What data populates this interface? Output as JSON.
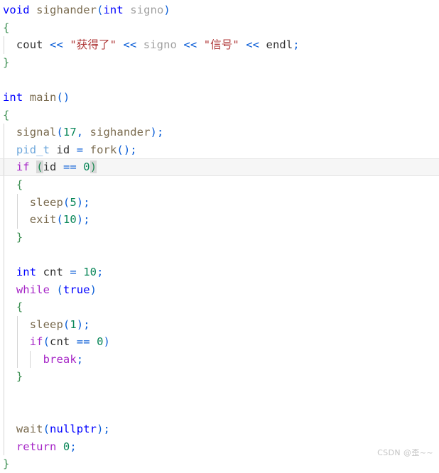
{
  "editor": {
    "language": "C++",
    "theme": "light",
    "background_color": "#ffffff",
    "current_line_number": 10,
    "current_line_highlight_color": "#f6f6f6",
    "bracket_match_highlight_color": "#d8d8d8",
    "indent_guide_color": "#d4d4d4",
    "colors": {
      "keyword": "#0000ff",
      "control_keyword": "#a626c7",
      "type": "#6fa8dc",
      "function": "#7a6b4f",
      "identifier": "#333333",
      "parameter": "#a0a0a0",
      "string": "#b03a3a",
      "number": "#098658",
      "punctuation": "#0b5ed7",
      "brace": "#3c8f52",
      "operator": "#0b5ed7"
    }
  },
  "code": {
    "lines": [
      {
        "n": 1,
        "current": false,
        "tokens": [
          {
            "t": "void",
            "c": "kw"
          },
          {
            "t": " ",
            "c": "ws"
          },
          {
            "t": "sighander",
            "c": "fn"
          },
          {
            "t": "(",
            "c": "punc"
          },
          {
            "t": "int",
            "c": "kw"
          },
          {
            "t": " ",
            "c": "ws"
          },
          {
            "t": "signo",
            "c": "param"
          },
          {
            "t": ")",
            "c": "punc"
          }
        ]
      },
      {
        "n": 2,
        "current": false,
        "tokens": [
          {
            "t": "{",
            "c": "brace"
          }
        ]
      },
      {
        "n": 3,
        "current": false,
        "indent": 1,
        "tokens": [
          {
            "t": "  ",
            "c": "ws"
          },
          {
            "t": "cout",
            "c": "id"
          },
          {
            "t": " ",
            "c": "ws"
          },
          {
            "t": "<<",
            "c": "op"
          },
          {
            "t": " ",
            "c": "ws"
          },
          {
            "t": "\"获得了\"",
            "c": "str"
          },
          {
            "t": " ",
            "c": "ws"
          },
          {
            "t": "<<",
            "c": "op"
          },
          {
            "t": " ",
            "c": "ws"
          },
          {
            "t": "signo",
            "c": "param"
          },
          {
            "t": " ",
            "c": "ws"
          },
          {
            "t": "<<",
            "c": "op"
          },
          {
            "t": " ",
            "c": "ws"
          },
          {
            "t": "\"信号\"",
            "c": "str"
          },
          {
            "t": " ",
            "c": "ws"
          },
          {
            "t": "<<",
            "c": "op"
          },
          {
            "t": " ",
            "c": "ws"
          },
          {
            "t": "endl",
            "c": "id"
          },
          {
            "t": ";",
            "c": "punc"
          }
        ]
      },
      {
        "n": 4,
        "current": false,
        "tokens": [
          {
            "t": "}",
            "c": "brace"
          }
        ]
      },
      {
        "n": 5,
        "current": false,
        "tokens": []
      },
      {
        "n": 6,
        "current": false,
        "tokens": [
          {
            "t": "int",
            "c": "kw"
          },
          {
            "t": " ",
            "c": "ws"
          },
          {
            "t": "main",
            "c": "fn"
          },
          {
            "t": "(",
            "c": "punc"
          },
          {
            "t": ")",
            "c": "punc"
          }
        ]
      },
      {
        "n": 7,
        "current": false,
        "tokens": [
          {
            "t": "{",
            "c": "brace"
          }
        ]
      },
      {
        "n": 8,
        "current": false,
        "indent": 1,
        "tokens": [
          {
            "t": "  ",
            "c": "ws"
          },
          {
            "t": "signal",
            "c": "fn"
          },
          {
            "t": "(",
            "c": "punc"
          },
          {
            "t": "17",
            "c": "num"
          },
          {
            "t": ",",
            "c": "punc"
          },
          {
            "t": " ",
            "c": "ws"
          },
          {
            "t": "sighander",
            "c": "fn"
          },
          {
            "t": ")",
            "c": "punc"
          },
          {
            "t": ";",
            "c": "punc"
          }
        ]
      },
      {
        "n": 9,
        "current": false,
        "indent": 1,
        "tokens": [
          {
            "t": "  ",
            "c": "ws"
          },
          {
            "t": "pid_t",
            "c": "type"
          },
          {
            "t": " ",
            "c": "ws"
          },
          {
            "t": "id",
            "c": "id"
          },
          {
            "t": " ",
            "c": "ws"
          },
          {
            "t": "=",
            "c": "op"
          },
          {
            "t": " ",
            "c": "ws"
          },
          {
            "t": "fork",
            "c": "fn"
          },
          {
            "t": "(",
            "c": "punc"
          },
          {
            "t": ")",
            "c": "punc"
          },
          {
            "t": ";",
            "c": "punc"
          }
        ]
      },
      {
        "n": 10,
        "current": true,
        "indent": 1,
        "tokens": [
          {
            "t": "  ",
            "c": "ws"
          },
          {
            "t": "if",
            "c": "ctrl"
          },
          {
            "t": " ",
            "c": "ws"
          },
          {
            "t": "(",
            "c": "match"
          },
          {
            "t": "id",
            "c": "id"
          },
          {
            "t": " ",
            "c": "ws"
          },
          {
            "t": "==",
            "c": "op"
          },
          {
            "t": " ",
            "c": "ws"
          },
          {
            "t": "0",
            "c": "num"
          },
          {
            "t": ")",
            "c": "match"
          }
        ]
      },
      {
        "n": 11,
        "current": false,
        "indent": 1,
        "tokens": [
          {
            "t": "  ",
            "c": "ws"
          },
          {
            "t": "{",
            "c": "brace"
          }
        ]
      },
      {
        "n": 12,
        "current": false,
        "indent": 2,
        "tokens": [
          {
            "t": "    ",
            "c": "ws"
          },
          {
            "t": "sleep",
            "c": "fn"
          },
          {
            "t": "(",
            "c": "punc"
          },
          {
            "t": "5",
            "c": "num"
          },
          {
            "t": ")",
            "c": "punc"
          },
          {
            "t": ";",
            "c": "punc"
          }
        ]
      },
      {
        "n": 13,
        "current": false,
        "indent": 2,
        "tokens": [
          {
            "t": "    ",
            "c": "ws"
          },
          {
            "t": "exit",
            "c": "fn"
          },
          {
            "t": "(",
            "c": "punc"
          },
          {
            "t": "10",
            "c": "num"
          },
          {
            "t": ")",
            "c": "punc"
          },
          {
            "t": ";",
            "c": "punc"
          }
        ]
      },
      {
        "n": 14,
        "current": false,
        "indent": 1,
        "tokens": [
          {
            "t": "  ",
            "c": "ws"
          },
          {
            "t": "}",
            "c": "brace"
          }
        ]
      },
      {
        "n": 15,
        "current": false,
        "indent": 1,
        "tokens": []
      },
      {
        "n": 16,
        "current": false,
        "indent": 1,
        "tokens": [
          {
            "t": "  ",
            "c": "ws"
          },
          {
            "t": "int",
            "c": "kw"
          },
          {
            "t": " ",
            "c": "ws"
          },
          {
            "t": "cnt",
            "c": "id"
          },
          {
            "t": " ",
            "c": "ws"
          },
          {
            "t": "=",
            "c": "op"
          },
          {
            "t": " ",
            "c": "ws"
          },
          {
            "t": "10",
            "c": "num"
          },
          {
            "t": ";",
            "c": "punc"
          }
        ]
      },
      {
        "n": 17,
        "current": false,
        "indent": 1,
        "tokens": [
          {
            "t": "  ",
            "c": "ws"
          },
          {
            "t": "while",
            "c": "ctrl"
          },
          {
            "t": " ",
            "c": "ws"
          },
          {
            "t": "(",
            "c": "punc"
          },
          {
            "t": "true",
            "c": "kw"
          },
          {
            "t": ")",
            "c": "punc"
          }
        ]
      },
      {
        "n": 18,
        "current": false,
        "indent": 1,
        "tokens": [
          {
            "t": "  ",
            "c": "ws"
          },
          {
            "t": "{",
            "c": "brace"
          }
        ]
      },
      {
        "n": 19,
        "current": false,
        "indent": 2,
        "tokens": [
          {
            "t": "    ",
            "c": "ws"
          },
          {
            "t": "sleep",
            "c": "fn"
          },
          {
            "t": "(",
            "c": "punc"
          },
          {
            "t": "1",
            "c": "num"
          },
          {
            "t": ")",
            "c": "punc"
          },
          {
            "t": ";",
            "c": "punc"
          }
        ]
      },
      {
        "n": 20,
        "current": false,
        "indent": 2,
        "tokens": [
          {
            "t": "    ",
            "c": "ws"
          },
          {
            "t": "if",
            "c": "ctrl"
          },
          {
            "t": "(",
            "c": "punc"
          },
          {
            "t": "cnt",
            "c": "id"
          },
          {
            "t": " ",
            "c": "ws"
          },
          {
            "t": "==",
            "c": "op"
          },
          {
            "t": " ",
            "c": "ws"
          },
          {
            "t": "0",
            "c": "num"
          },
          {
            "t": ")",
            "c": "punc"
          }
        ]
      },
      {
        "n": 21,
        "current": false,
        "indent": 3,
        "tokens": [
          {
            "t": "      ",
            "c": "ws"
          },
          {
            "t": "break",
            "c": "ctrl"
          },
          {
            "t": ";",
            "c": "punc"
          }
        ]
      },
      {
        "n": 22,
        "current": false,
        "indent": 1,
        "tokens": [
          {
            "t": "  ",
            "c": "ws"
          },
          {
            "t": "}",
            "c": "brace"
          }
        ]
      },
      {
        "n": 23,
        "current": false,
        "indent": 1,
        "tokens": []
      },
      {
        "n": 24,
        "current": false,
        "indent": 1,
        "tokens": []
      },
      {
        "n": 25,
        "current": false,
        "indent": 1,
        "tokens": [
          {
            "t": "  ",
            "c": "ws"
          },
          {
            "t": "wait",
            "c": "fn"
          },
          {
            "t": "(",
            "c": "punc"
          },
          {
            "t": "nullptr",
            "c": "kw"
          },
          {
            "t": ")",
            "c": "punc"
          },
          {
            "t": ";",
            "c": "punc"
          }
        ]
      },
      {
        "n": 26,
        "current": false,
        "indent": 1,
        "tokens": [
          {
            "t": "  ",
            "c": "ws"
          },
          {
            "t": "return",
            "c": "ctrl"
          },
          {
            "t": " ",
            "c": "ws"
          },
          {
            "t": "0",
            "c": "num"
          },
          {
            "t": ";",
            "c": "punc"
          }
        ]
      },
      {
        "n": 27,
        "current": false,
        "tokens": [
          {
            "t": "}",
            "c": "brace"
          }
        ]
      }
    ]
  },
  "watermark": {
    "text": "CSDN @歪~~"
  }
}
